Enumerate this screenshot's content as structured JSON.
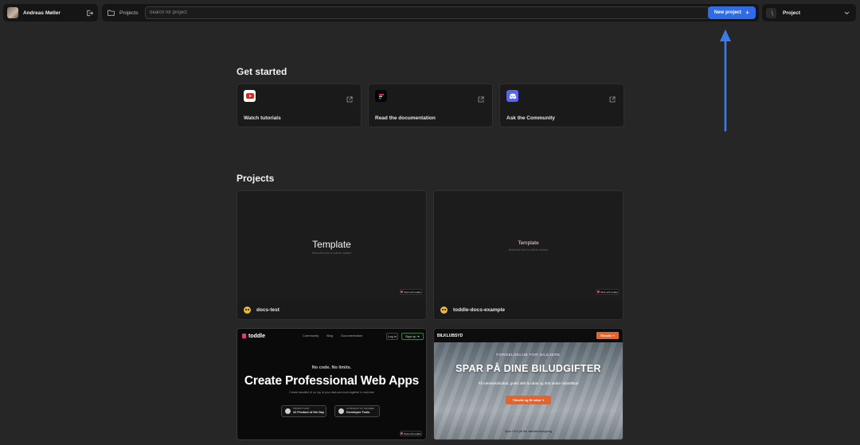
{
  "user": {
    "name": "Andreas Møller"
  },
  "header": {
    "breadcrumb": "Projects",
    "search_placeholder": "Search for project",
    "new_project_label": "New project",
    "project_select_label": "Project"
  },
  "get_started": {
    "title": "Get started",
    "cards": [
      {
        "label": "Watch tutorials",
        "icon": "youtube-icon"
      },
      {
        "label": "Read the documentation",
        "icon": "toddle-icon"
      },
      {
        "label": "Ask the Community",
        "icon": "discord-icon"
      }
    ]
  },
  "projects": {
    "title": "Projects",
    "items": [
      {
        "name": "docs-test",
        "preview_title": "Template",
        "preview_sub": "Select the text to edit its content",
        "badge": "Built with toddle"
      },
      {
        "name": "toddle-docs-example",
        "preview_title": "Template",
        "preview_sub": "Select the text to edit its content",
        "badge": "Built with toddle"
      }
    ],
    "toddle_preview": {
      "logo": "toddle",
      "links": [
        "Community",
        "Blog",
        "Documentation"
      ],
      "login": "Log in",
      "signup": "Sign up",
      "tag": "No code. No limits.",
      "headline": "Create Professional Web Apps",
      "desc": "Create beautiful UI on top of your data and work together in real-time",
      "badge1_top": "PRODUCT HUNT",
      "badge1": "#2 Product of the Day",
      "badge2_top": "#1 PRODUCT OF THE WEEK",
      "badge2": "Developer Tools",
      "built": "Built with toddle"
    },
    "bilklub_preview": {
      "logo": "BILKLUBSYD",
      "cta": "Tilmeld",
      "eyebrow": "FORDELSKLUB FOR BILEJERE",
      "headline": "SPAR PÅ DINE BILUDGIFTER",
      "sub": "Få værkstedsrabat, gratis skilt & rabat og 500 andre rabattilbud",
      "button": "Tilmeld og få rabat",
      "note": "Spar 10% på din værkstedsregning"
    }
  },
  "colors": {
    "accent": "#2f6be8",
    "arrow": "#3b7bea",
    "bg": "#262626",
    "card": "#1a1a1a"
  }
}
